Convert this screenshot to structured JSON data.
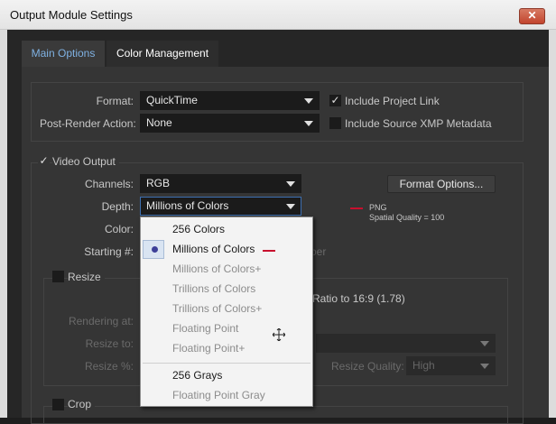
{
  "window": {
    "title": "Output Module Settings",
    "close_glyph": "✕"
  },
  "tabs": [
    {
      "label": "Main Options",
      "active": true
    },
    {
      "label": "Color Management",
      "active": false
    }
  ],
  "main": {
    "format_label": "Format:",
    "format_value": "QuickTime",
    "include_project_link_label": "Include Project Link",
    "include_project_link_checked": true,
    "post_render_label": "Post-Render Action:",
    "post_render_value": "None",
    "include_xmp_label": "Include Source XMP Metadata",
    "include_xmp_checked": false
  },
  "video_output": {
    "label": "Video Output",
    "checked": true,
    "channels_label": "Channels:",
    "channels_value": "RGB",
    "format_options_button": "Format Options...",
    "depth_label": "Depth:",
    "depth_value": "Millions of Colors",
    "color_label": "Color:",
    "starting_label": "Starting #:",
    "use_comp_frame_partial": "ber",
    "format_info_line1": "PNG",
    "format_info_line2": "Spatial Quality = 100",
    "accent_color": "#c8102e"
  },
  "resize": {
    "label": "Resize",
    "lock_ratio_partial": "Ratio to 16:9 (1.78)",
    "rendering_at_label": "Rendering at:",
    "resize_to_label": "Resize to:",
    "resize_pct_label": "Resize %:",
    "quality_label": "Resize Quality:",
    "quality_value": "High"
  },
  "crop": {
    "label": "Crop"
  },
  "depth_menu": {
    "items": [
      {
        "label": "256 Colors",
        "enabled": true,
        "selected": false
      },
      {
        "label": "Millions of Colors",
        "enabled": true,
        "selected": true
      },
      {
        "label": "Millions of Colors+",
        "enabled": false,
        "selected": false
      },
      {
        "label": "Trillions of Colors",
        "enabled": false,
        "selected": false
      },
      {
        "label": "Trillions of Colors+",
        "enabled": false,
        "selected": false
      },
      {
        "label": "Floating Point",
        "enabled": false,
        "selected": false
      },
      {
        "label": "Floating Point+",
        "enabled": false,
        "selected": false
      },
      {
        "label": "256 Grays",
        "enabled": true,
        "selected": false
      },
      {
        "label": "Floating Point Gray",
        "enabled": false,
        "selected": false
      }
    ],
    "selected_color": "#3d3f98"
  }
}
